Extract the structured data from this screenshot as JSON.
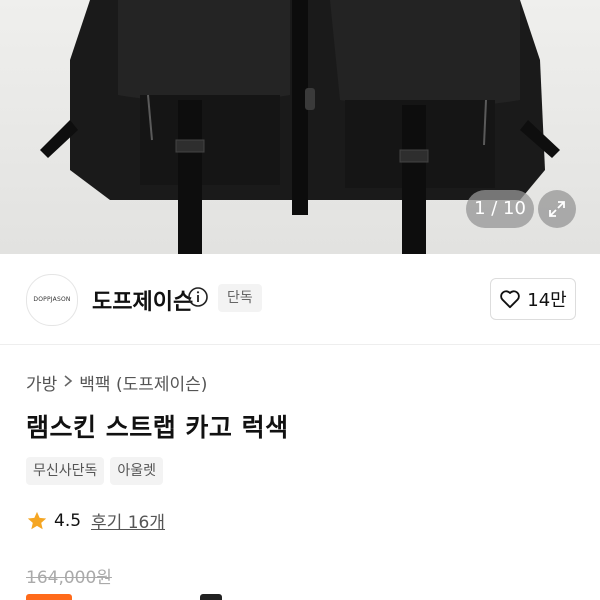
{
  "image_counter": {
    "current": "1",
    "total": "10",
    "text": "1 / 10"
  },
  "icons": {
    "expand": "expand-arrows-icon",
    "info": "info-circle-icon",
    "heart": "heart-outline-icon",
    "star": "star-icon",
    "chevron": "chevron-right-icon"
  },
  "seller": {
    "logo_text": "DOPPJASON",
    "name": "도프제이슨",
    "badge": "단독",
    "likes": "14만"
  },
  "breadcrumb": {
    "items": [
      "가방",
      "백팩 (도프제이슨)"
    ]
  },
  "product": {
    "title": "램스킨 스트랩 카고 럭색",
    "tags": [
      "무신사단독",
      "아울렛"
    ],
    "rating": "4.5",
    "reviews": "후기 16개",
    "original_price": "164,000원"
  },
  "colors": {
    "star": "#f5a623",
    "sale": "#ff6a1a",
    "badge_bg": "#f3f3f3"
  }
}
